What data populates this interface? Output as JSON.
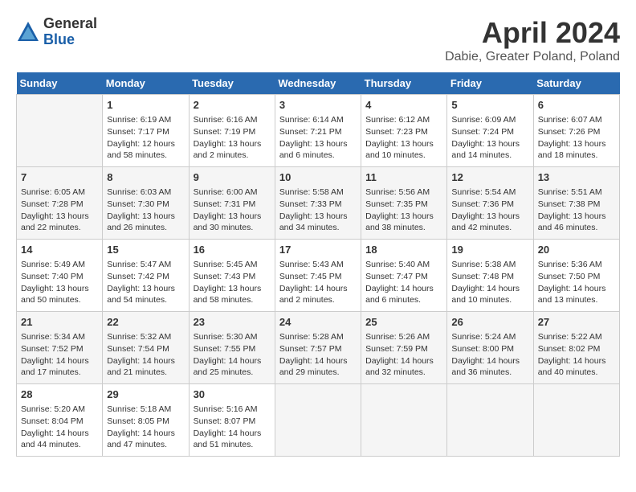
{
  "header": {
    "logo_general": "General",
    "logo_blue": "Blue",
    "title": "April 2024",
    "subtitle": "Dabie, Greater Poland, Poland"
  },
  "calendar": {
    "days_of_week": [
      "Sunday",
      "Monday",
      "Tuesday",
      "Wednesday",
      "Thursday",
      "Friday",
      "Saturday"
    ],
    "weeks": [
      [
        {
          "day": "",
          "info": ""
        },
        {
          "day": "1",
          "info": "Sunrise: 6:19 AM\nSunset: 7:17 PM\nDaylight: 12 hours\nand 58 minutes."
        },
        {
          "day": "2",
          "info": "Sunrise: 6:16 AM\nSunset: 7:19 PM\nDaylight: 13 hours\nand 2 minutes."
        },
        {
          "day": "3",
          "info": "Sunrise: 6:14 AM\nSunset: 7:21 PM\nDaylight: 13 hours\nand 6 minutes."
        },
        {
          "day": "4",
          "info": "Sunrise: 6:12 AM\nSunset: 7:23 PM\nDaylight: 13 hours\nand 10 minutes."
        },
        {
          "day": "5",
          "info": "Sunrise: 6:09 AM\nSunset: 7:24 PM\nDaylight: 13 hours\nand 14 minutes."
        },
        {
          "day": "6",
          "info": "Sunrise: 6:07 AM\nSunset: 7:26 PM\nDaylight: 13 hours\nand 18 minutes."
        }
      ],
      [
        {
          "day": "7",
          "info": "Sunrise: 6:05 AM\nSunset: 7:28 PM\nDaylight: 13 hours\nand 22 minutes."
        },
        {
          "day": "8",
          "info": "Sunrise: 6:03 AM\nSunset: 7:30 PM\nDaylight: 13 hours\nand 26 minutes."
        },
        {
          "day": "9",
          "info": "Sunrise: 6:00 AM\nSunset: 7:31 PM\nDaylight: 13 hours\nand 30 minutes."
        },
        {
          "day": "10",
          "info": "Sunrise: 5:58 AM\nSunset: 7:33 PM\nDaylight: 13 hours\nand 34 minutes."
        },
        {
          "day": "11",
          "info": "Sunrise: 5:56 AM\nSunset: 7:35 PM\nDaylight: 13 hours\nand 38 minutes."
        },
        {
          "day": "12",
          "info": "Sunrise: 5:54 AM\nSunset: 7:36 PM\nDaylight: 13 hours\nand 42 minutes."
        },
        {
          "day": "13",
          "info": "Sunrise: 5:51 AM\nSunset: 7:38 PM\nDaylight: 13 hours\nand 46 minutes."
        }
      ],
      [
        {
          "day": "14",
          "info": "Sunrise: 5:49 AM\nSunset: 7:40 PM\nDaylight: 13 hours\nand 50 minutes."
        },
        {
          "day": "15",
          "info": "Sunrise: 5:47 AM\nSunset: 7:42 PM\nDaylight: 13 hours\nand 54 minutes."
        },
        {
          "day": "16",
          "info": "Sunrise: 5:45 AM\nSunset: 7:43 PM\nDaylight: 13 hours\nand 58 minutes."
        },
        {
          "day": "17",
          "info": "Sunrise: 5:43 AM\nSunset: 7:45 PM\nDaylight: 14 hours\nand 2 minutes."
        },
        {
          "day": "18",
          "info": "Sunrise: 5:40 AM\nSunset: 7:47 PM\nDaylight: 14 hours\nand 6 minutes."
        },
        {
          "day": "19",
          "info": "Sunrise: 5:38 AM\nSunset: 7:48 PM\nDaylight: 14 hours\nand 10 minutes."
        },
        {
          "day": "20",
          "info": "Sunrise: 5:36 AM\nSunset: 7:50 PM\nDaylight: 14 hours\nand 13 minutes."
        }
      ],
      [
        {
          "day": "21",
          "info": "Sunrise: 5:34 AM\nSunset: 7:52 PM\nDaylight: 14 hours\nand 17 minutes."
        },
        {
          "day": "22",
          "info": "Sunrise: 5:32 AM\nSunset: 7:54 PM\nDaylight: 14 hours\nand 21 minutes."
        },
        {
          "day": "23",
          "info": "Sunrise: 5:30 AM\nSunset: 7:55 PM\nDaylight: 14 hours\nand 25 minutes."
        },
        {
          "day": "24",
          "info": "Sunrise: 5:28 AM\nSunset: 7:57 PM\nDaylight: 14 hours\nand 29 minutes."
        },
        {
          "day": "25",
          "info": "Sunrise: 5:26 AM\nSunset: 7:59 PM\nDaylight: 14 hours\nand 32 minutes."
        },
        {
          "day": "26",
          "info": "Sunrise: 5:24 AM\nSunset: 8:00 PM\nDaylight: 14 hours\nand 36 minutes."
        },
        {
          "day": "27",
          "info": "Sunrise: 5:22 AM\nSunset: 8:02 PM\nDaylight: 14 hours\nand 40 minutes."
        }
      ],
      [
        {
          "day": "28",
          "info": "Sunrise: 5:20 AM\nSunset: 8:04 PM\nDaylight: 14 hours\nand 44 minutes."
        },
        {
          "day": "29",
          "info": "Sunrise: 5:18 AM\nSunset: 8:05 PM\nDaylight: 14 hours\nand 47 minutes."
        },
        {
          "day": "30",
          "info": "Sunrise: 5:16 AM\nSunset: 8:07 PM\nDaylight: 14 hours\nand 51 minutes."
        },
        {
          "day": "",
          "info": ""
        },
        {
          "day": "",
          "info": ""
        },
        {
          "day": "",
          "info": ""
        },
        {
          "day": "",
          "info": ""
        }
      ]
    ]
  }
}
